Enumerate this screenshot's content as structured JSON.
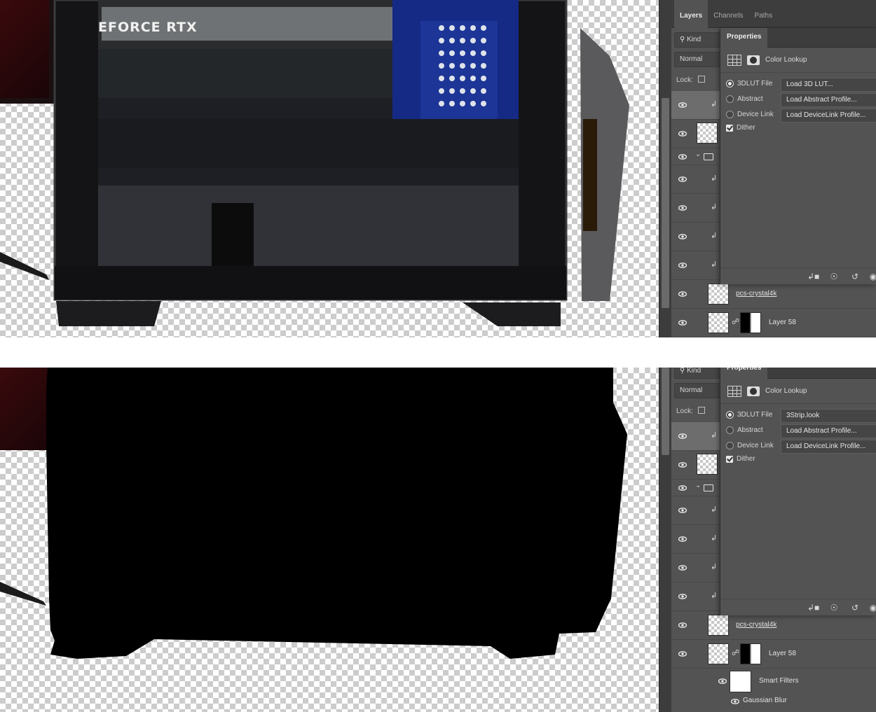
{
  "top_view": {
    "canvas": {
      "gpu_label": "EFORCE RTX"
    },
    "panel_tabs": [
      "Layers",
      "Channels",
      "Paths"
    ],
    "filter_kind": "Kind",
    "blend_mode": "Normal",
    "lock_label": "Lock:",
    "properties": {
      "tab": "Properties",
      "adjustment_title": "Color Lookup",
      "options": [
        {
          "label": "3DLUT File",
          "value": "Load 3D LUT..."
        },
        {
          "label": "Abstract",
          "value": "Load Abstract Profile..."
        },
        {
          "label": "Device Link",
          "value": "Load DeviceLink Profile..."
        }
      ],
      "dither_label": "Dither"
    },
    "layers": [
      {
        "name": "pcs-crystal4k"
      },
      {
        "name": "Layer 58"
      }
    ]
  },
  "bottom_view": {
    "filter_kind": "Kind",
    "blend_mode": "Normal",
    "lock_label": "Lock:",
    "properties": {
      "tab": "Properties",
      "adjustment_title": "Color Lookup",
      "options": [
        {
          "label": "3DLUT File",
          "value": "3Strip.look"
        },
        {
          "label": "Abstract",
          "value": "Load Abstract Profile..."
        },
        {
          "label": "Device Link",
          "value": "Load DeviceLink Profile..."
        }
      ],
      "dither_label": "Dither"
    },
    "layers": [
      {
        "name": "pcs-crystal4k"
      },
      {
        "name": "Layer 58"
      },
      {
        "name": "Smart Filters"
      },
      {
        "name": "Gaussian Blur"
      }
    ]
  },
  "icons": {
    "visibility": "eye-icon",
    "search": "search-icon",
    "folder": "folder-icon",
    "clip": "clipping-arrow-icon",
    "link": "chain-link-icon",
    "lock_transparency": "lock-checker-icon"
  }
}
